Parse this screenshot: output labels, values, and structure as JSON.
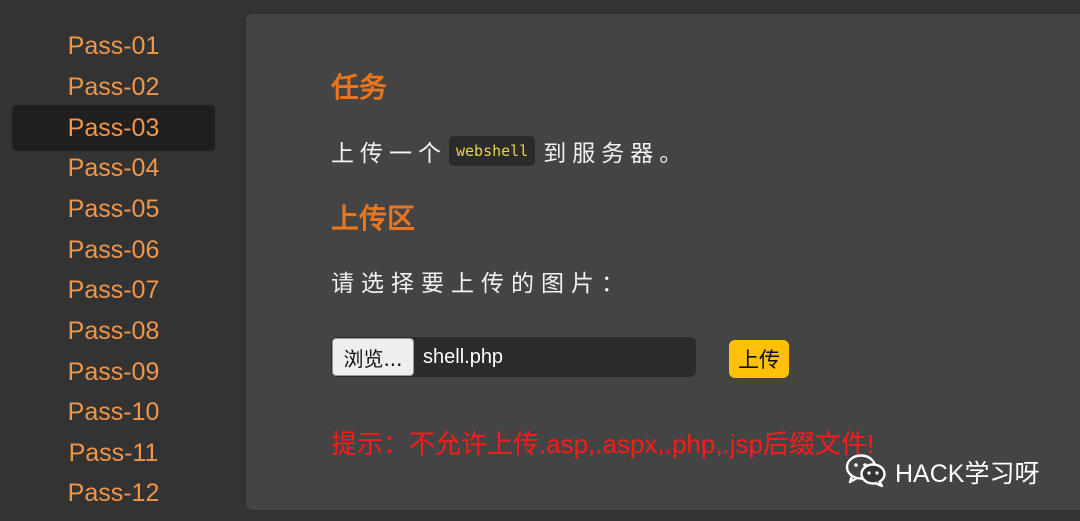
{
  "sidebar": {
    "items": [
      {
        "label": "Pass-01"
      },
      {
        "label": "Pass-02"
      },
      {
        "label": "Pass-03",
        "active": true
      },
      {
        "label": "Pass-04"
      },
      {
        "label": "Pass-05"
      },
      {
        "label": "Pass-06"
      },
      {
        "label": "Pass-07"
      },
      {
        "label": "Pass-08"
      },
      {
        "label": "Pass-09"
      },
      {
        "label": "Pass-10"
      },
      {
        "label": "Pass-11"
      },
      {
        "label": "Pass-12"
      }
    ]
  },
  "task": {
    "heading": "任务",
    "text_before": "上传一个",
    "code": "webshell",
    "text_after": "到服务器。"
  },
  "upload": {
    "heading": "上传区",
    "prompt": "请选择要上传的图片：",
    "browse_label": "浏览...",
    "file_name": "shell.php",
    "submit_label": "上传"
  },
  "hint": "提示：不允许上传.asp,.aspx,.php,.jsp后缀文件!",
  "watermark": {
    "text": "HACK学习呀",
    "icon": "wechat-icon"
  },
  "colors": {
    "nav_text": "#f0964a",
    "heading": "#e8761f",
    "hint": "#ff1a1a",
    "upload_button": "#ffc106"
  }
}
